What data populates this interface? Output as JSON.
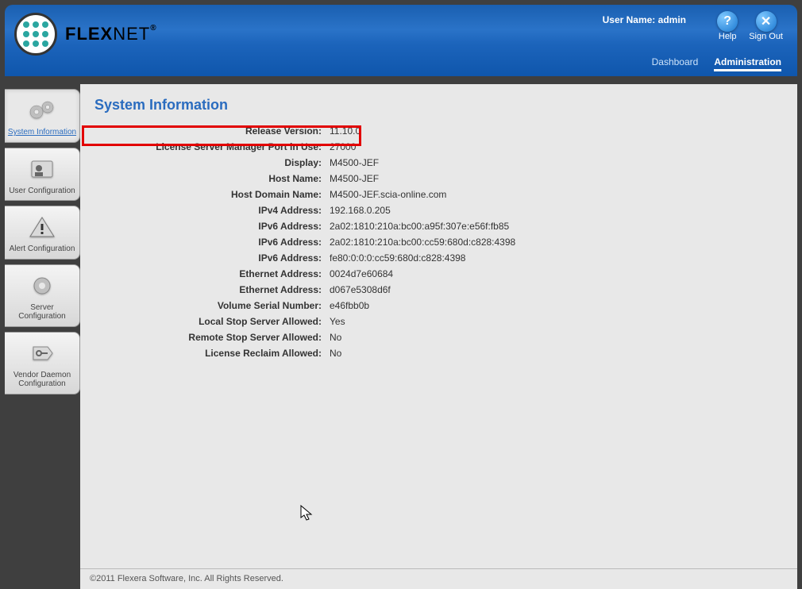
{
  "header": {
    "brand_bold": "FLEX",
    "brand_thin": "NET",
    "brand_reg": "®",
    "user_label": "User Name:",
    "user_value": "admin",
    "help": "Help",
    "signout": "Sign Out",
    "nav": {
      "dashboard": "Dashboard",
      "administration": "Administration"
    }
  },
  "sidebar": {
    "items": [
      {
        "label": "System Information"
      },
      {
        "label": "User Configuration"
      },
      {
        "label": "Alert Configuration"
      },
      {
        "label": "Server Configuration"
      },
      {
        "label": "Vendor Daemon Configuration"
      }
    ]
  },
  "page": {
    "title": "System Information",
    "rows": [
      {
        "label": "Release Version:",
        "value": "11.10.0"
      },
      {
        "label": "License Server Manager Port in Use:",
        "value": "27000"
      },
      {
        "label": "Display:",
        "value": "M4500-JEF"
      },
      {
        "label": "Host Name:",
        "value": "M4500-JEF"
      },
      {
        "label": "Host Domain Name:",
        "value": "M4500-JEF.scia-online.com"
      },
      {
        "label": "IPv4 Address:",
        "value": "192.168.0.205"
      },
      {
        "label": "IPv6 Address:",
        "value": "2a02:1810:210a:bc00:a95f:307e:e56f:fb85"
      },
      {
        "label": "IPv6 Address:",
        "value": "2a02:1810:210a:bc00:cc59:680d:c828:4398"
      },
      {
        "label": "IPv6 Address:",
        "value": "fe80:0:0:0:cc59:680d:c828:4398"
      },
      {
        "label": "Ethernet Address:",
        "value": "0024d7e60684"
      },
      {
        "label": "Ethernet Address:",
        "value": "d067e5308d6f"
      },
      {
        "label": "Volume Serial Number:",
        "value": "e46fbb0b"
      },
      {
        "label": "Local Stop Server Allowed:",
        "value": "Yes"
      },
      {
        "label": "Remote Stop Server Allowed:",
        "value": "No"
      },
      {
        "label": "License Reclaim Allowed:",
        "value": "No"
      }
    ]
  },
  "footer": {
    "copyright": "©2011 Flexera Software, Inc. All Rights Reserved."
  }
}
